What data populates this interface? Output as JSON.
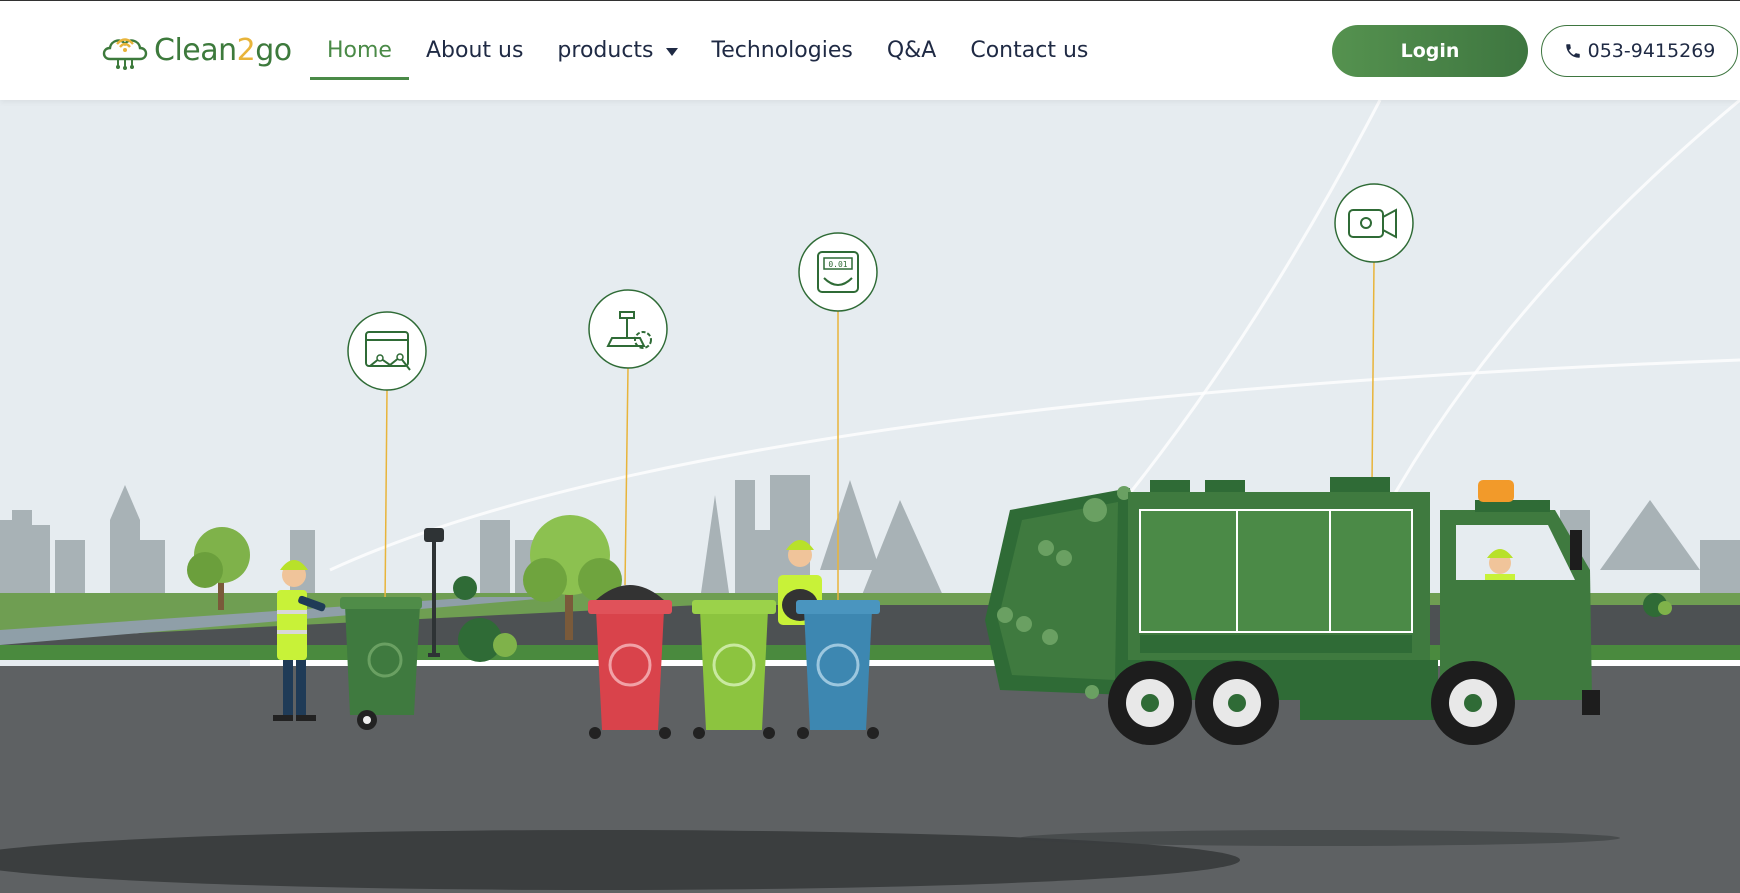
{
  "brand": {
    "name_part1": "Clean",
    "name_part2": "2",
    "name_part3": "go"
  },
  "nav": {
    "items": [
      {
        "label": "Home"
      },
      {
        "label": "About us"
      },
      {
        "label": "products"
      },
      {
        "label": "Technologies"
      },
      {
        "label": "Q&A"
      },
      {
        "label": "Contact us"
      }
    ]
  },
  "header": {
    "login_label": "Login",
    "phone_label": "053-9415269"
  },
  "hero": {
    "scale_display": "0.01",
    "icons": [
      "dashboard-analytics-icon",
      "weighing-scale-icon",
      "scale-display-icon",
      "camera-icon"
    ],
    "colors": {
      "brand_green": "#4a8a47",
      "truck_green": "#3f7a3f",
      "bin_red": "#d9434b",
      "bin_green": "#8cc43f",
      "bin_blue": "#3d87b1",
      "sky": "#e7edf1",
      "road": "#5d6062",
      "accent_orange": "#f29a2a"
    }
  }
}
